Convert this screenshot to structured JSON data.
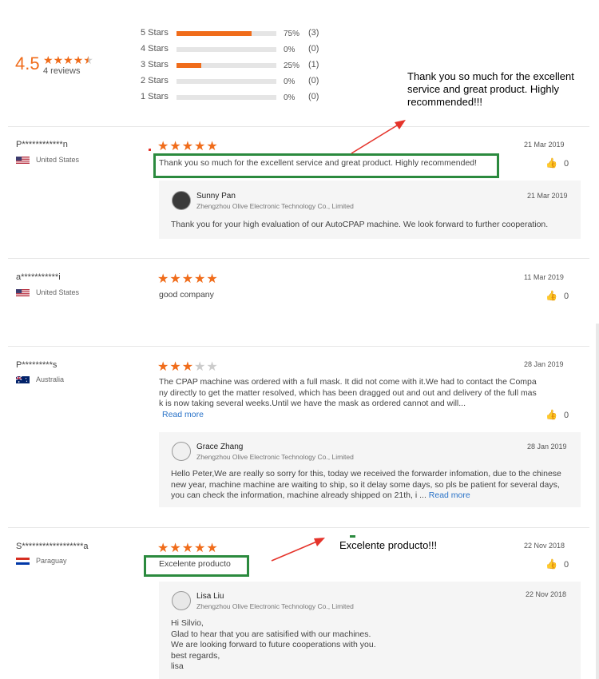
{
  "summary": {
    "score": "4.5",
    "reviews_label": "4 reviews",
    "star_rating": 4.5,
    "accent_color": "#f06c1a",
    "breakdown": [
      {
        "label": "5 Stars",
        "pct": "75%",
        "count": "(3)",
        "fill": 0.75
      },
      {
        "label": "4 Stars",
        "pct": "0%",
        "count": "(0)",
        "fill": 0
      },
      {
        "label": "3 Stars",
        "pct": "25%",
        "count": "(1)",
        "fill": 0.25
      },
      {
        "label": "2 Stars",
        "pct": "0%",
        "count": "(0)",
        "fill": 0
      },
      {
        "label": "1 Stars",
        "pct": "0%",
        "count": "(0)",
        "fill": 0
      }
    ]
  },
  "annotations": {
    "note1": "Thank you so much for the excellent service and great product.  Highly recommended!!!",
    "note2": "Excelente producto!!!",
    "annotation_color": "#e5332a",
    "highlight_color": "#2b8a3e"
  },
  "reviews": [
    {
      "name": "P************n",
      "country": "United States",
      "flag_icon": "us-flag-icon",
      "stars": 5,
      "date": "21 Mar 2019",
      "text": "Thank you so much for the excellent service and great product.  Highly recommended!",
      "likes": "0",
      "reply": {
        "name": "Sunny Pan",
        "company": "Zhengzhou Olive Electronic Technology Co., Limited",
        "date": "21 Mar 2019",
        "text": "Thank you for your high evaluation of our AutoCPAP machine.  We look forward to further cooperation."
      }
    },
    {
      "name": "a***********i",
      "country": "United States",
      "flag_icon": "us-flag-icon",
      "stars": 5,
      "date": "11 Mar 2019",
      "text": "good company",
      "likes": "0"
    },
    {
      "name": "P*********s",
      "country": "Australia",
      "flag_icon": "australia-flag-icon",
      "stars": 3,
      "date": "28 Jan 2019",
      "text_lines": [
        "The CPAP machine was ordered with a full mask. It did not come with it.We had to contact the Compa",
        "ny directly to get the matter resolved, which has been dragged out and out and delivery of the full mas",
        "k is now taking several weeks.Until we have the mask as ordered cannot and will..."
      ],
      "read_more": "Read more",
      "likes": "0",
      "reply": {
        "name": "Grace Zhang",
        "company": "Zhengzhou Olive Electronic Technology Co., Limited",
        "date": "28 Jan 2019",
        "text_lines": [
          "Hello Peter,We are really so sorry for this, today we received the forwarder infomation, due to the chinese",
          " new year, machine machine are waiting to ship, so it delay some days, so pls be patient for several days,",
          "you can check the information, machine already shipped on 21th, i ..."
        ],
        "read_more": "Read more"
      }
    },
    {
      "name": "S******************a",
      "country": "Paraguay",
      "flag_icon": "paraguay-flag-icon",
      "stars": 5,
      "date": "22 Nov 2018",
      "text": "Excelente producto",
      "likes": "0",
      "reply": {
        "name": "Lisa Liu",
        "company": "Zhengzhou Olive Electronic Technology Co., Limited",
        "date": "22 Nov 2018",
        "text_lines": [
          "Hi Silvio,",
          "Glad to hear that you are satisified with our machines.",
          "We are looking forward to future cooperations with you.",
          "best regards,",
          "lisa"
        ]
      }
    }
  ]
}
